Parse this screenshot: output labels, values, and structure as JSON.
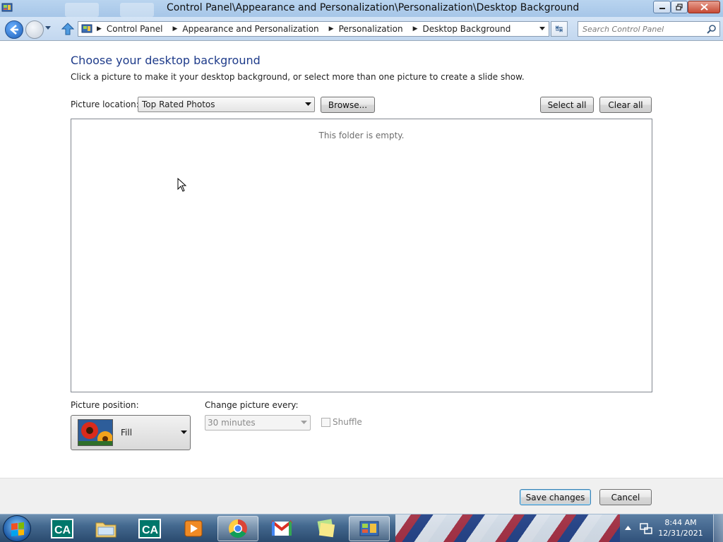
{
  "window": {
    "title": "Control Panel\\Appearance and Personalization\\Personalization\\Desktop Background"
  },
  "address_bar": {
    "breadcrumbs": [
      "Control Panel",
      "Appearance and Personalization",
      "Personalization",
      "Desktop Background"
    ],
    "search_placeholder": "Search Control Panel"
  },
  "content": {
    "heading": "Choose your desktop background",
    "description": "Click a picture to make it your desktop background, or select more than one picture to create a slide show.",
    "picture_location_label": "Picture location:",
    "picture_location_value": "Top Rated Photos",
    "browse_label": "Browse...",
    "select_all_label": "Select all",
    "clear_all_label": "Clear all",
    "empty_message": "This folder is empty.",
    "picture_position_label": "Picture position:",
    "picture_position_value": "Fill",
    "change_every_label": "Change picture every:",
    "change_every_value": "30 minutes",
    "shuffle_label": "Shuffle",
    "shuffle_checked": false
  },
  "footer": {
    "save_label": "Save changes",
    "cancel_label": "Cancel"
  },
  "taskbar": {
    "items": [
      "credit-agricole-app",
      "file-explorer",
      "credit-agricole-app",
      "media-player",
      "chrome",
      "gmail",
      "sticky-notes",
      "control-panel"
    ],
    "active_item": "control-panel",
    "clock_time": "8:44 AM",
    "clock_date": "12/31/2021"
  },
  "colors": {
    "heading": "#1e3b8a",
    "titlebar": "#b9d4ef",
    "taskbar": "#2a4a6e"
  }
}
